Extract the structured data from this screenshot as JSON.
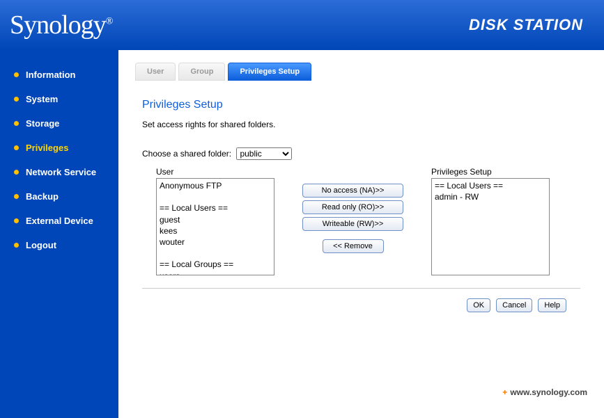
{
  "header": {
    "logo_text": "Synology",
    "product_name": "DISK STATION"
  },
  "sidebar": {
    "items": [
      {
        "label": "Information"
      },
      {
        "label": "System"
      },
      {
        "label": "Storage"
      },
      {
        "label": "Privileges"
      },
      {
        "label": "Network Service"
      },
      {
        "label": "Backup"
      },
      {
        "label": "External Device"
      },
      {
        "label": "Logout"
      }
    ]
  },
  "tabs": {
    "user": "User",
    "group": "Group",
    "priv": "Privileges Setup"
  },
  "panel": {
    "title": "Privileges Setup",
    "description": "Set access rights for shared folders.",
    "folder_label": "Choose a shared folder:",
    "folder_value": "public",
    "user_col_label": "User",
    "priv_col_label": "Privileges Setup",
    "users": [
      "Anonymous FTP",
      "",
      "== Local Users ==",
      "guest",
      "kees",
      "wouter",
      "",
      "== Local Groups ==",
      "users"
    ],
    "assigned": [
      "== Local Users ==",
      "admin - RW"
    ],
    "btn_na": "No access (NA)>>",
    "btn_ro": "Read only (RO)>>",
    "btn_rw": "Writeable (RW)>>",
    "btn_remove": "<< Remove",
    "btn_ok": "OK",
    "btn_cancel": "Cancel",
    "btn_help": "Help"
  },
  "footer": {
    "site": "www.synology.com"
  }
}
